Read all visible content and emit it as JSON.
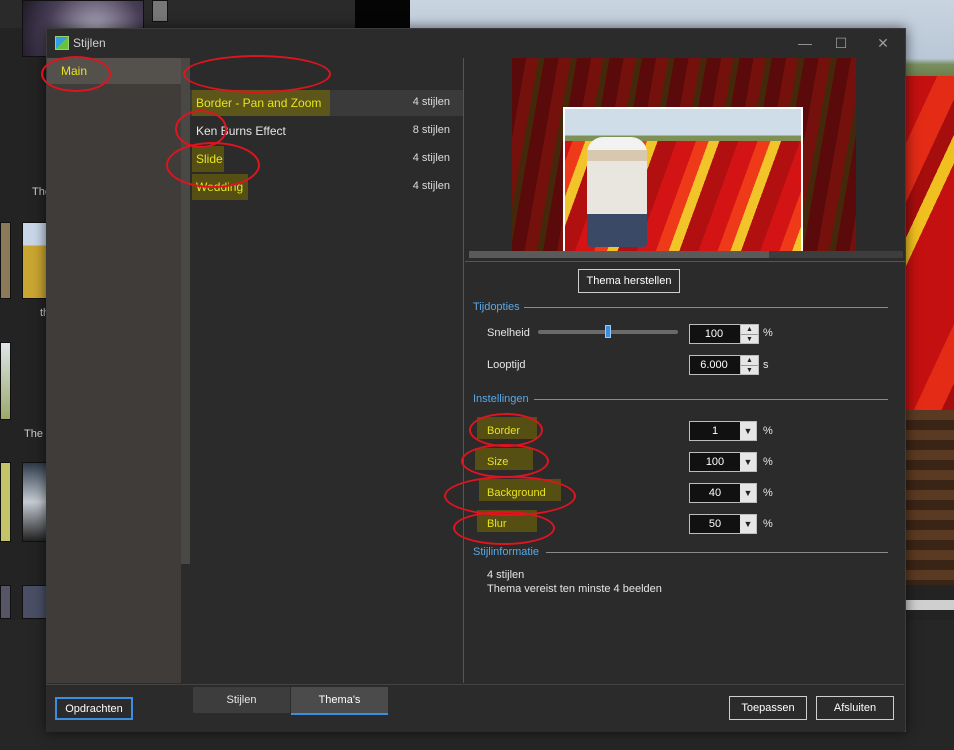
{
  "window": {
    "title": "Stijlen"
  },
  "background": {
    "captions": [
      "The",
      "th",
      "The I"
    ]
  },
  "categories": [
    {
      "label": "Main"
    }
  ],
  "styles": [
    {
      "name": "Border - Pan and Zoom",
      "count": "4 stijlen"
    },
    {
      "name": "Ken Burns Effect",
      "count": "8 stijlen"
    },
    {
      "name": "Slide",
      "count": "4 stijlen"
    },
    {
      "name": "Wedding",
      "count": "4 stijlen"
    }
  ],
  "restore_button": "Thema herstellen",
  "time_options": {
    "title": "Tijdopties",
    "speed": {
      "label": "Snelheid",
      "value": "100",
      "unit": "%",
      "slider_fraction": 0.5
    },
    "duration": {
      "label": "Looptijd",
      "value": "6.000",
      "unit": "s"
    }
  },
  "settings": {
    "title": "Instellingen",
    "items": [
      {
        "label": "Border",
        "value": "1",
        "unit": "%"
      },
      {
        "label": "Size",
        "value": "100",
        "unit": "%"
      },
      {
        "label": "Background",
        "value": "40",
        "unit": "%"
      },
      {
        "label": "Blur",
        "value": "50",
        "unit": "%"
      }
    ]
  },
  "style_info": {
    "title": "Stijlinformatie",
    "line1": "4 stijlen",
    "line2": "Thema vereist ten minste 4 beelden"
  },
  "footer": {
    "tasks_button": "Opdrachten",
    "tabs": [
      "Stijlen",
      "Thema's"
    ],
    "apply_button": "Toepassen",
    "close_button": "Afsluiten"
  },
  "colors": {
    "accent": "#3c8ee0",
    "section": "#5ba8e6",
    "highlight_text": "#e8e41e",
    "annotation": "#e0141e"
  }
}
